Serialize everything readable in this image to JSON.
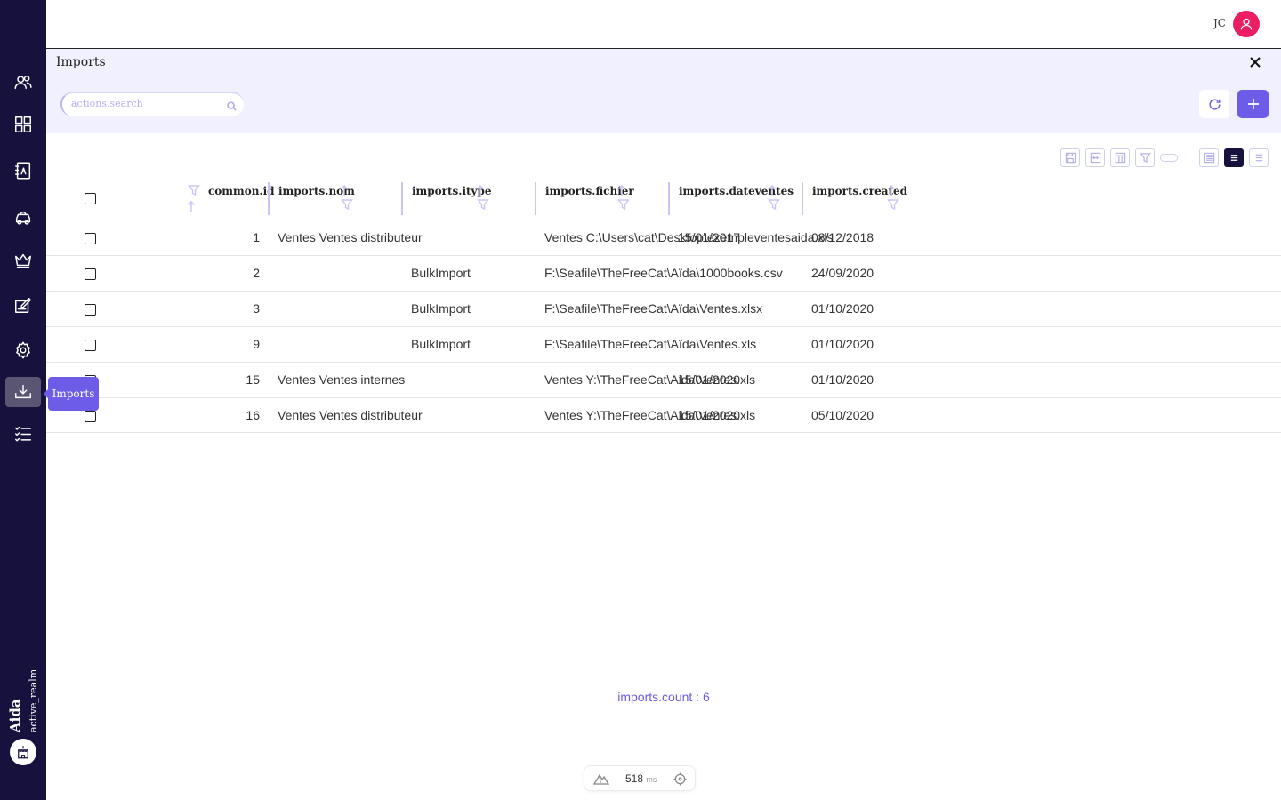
{
  "sidebar": {
    "items": [
      {
        "name": "users-icon"
      },
      {
        "name": "dashboard-icon"
      },
      {
        "name": "contacts-book-icon"
      },
      {
        "name": "car-icon"
      },
      {
        "name": "crown-icon"
      },
      {
        "name": "report-edit-icon"
      },
      {
        "name": "gear-icon"
      },
      {
        "name": "download-tray-icon",
        "active": true
      },
      {
        "name": "checklist-icon"
      }
    ],
    "tooltip": "Imports",
    "brand": "Aida",
    "realm": "active_realm",
    "realm_icon": "castle-icon"
  },
  "topbar": {
    "user_initials": "JC",
    "avatar_color": "#e91e63"
  },
  "panel": {
    "title": "Imports",
    "search_placeholder": "actions.search"
  },
  "colors": {
    "accent": "#6c5ce7",
    "sidebar_bg": "#17123d",
    "panel_bg": "#f1f0ff"
  },
  "table": {
    "columns": [
      "common.id",
      "imports.nom",
      "imports.itype",
      "imports.fichier",
      "imports.dateventes",
      "imports.created"
    ],
    "rows": [
      {
        "id": "1",
        "nom": "Ventes Ventes distributeur",
        "itype": "",
        "fichier": "Ventes C:\\Users\\cat\\Desktop\\exempleventesaida.xls",
        "dateventes": "15/01/2017",
        "created": "08/12/2018"
      },
      {
        "id": "2",
        "nom": "",
        "itype": "BulkImport",
        "fichier": "F:\\Seafile\\TheFreeCat\\Aïda\\1000books.csv",
        "dateventes": "",
        "created": "24/09/2020"
      },
      {
        "id": "3",
        "nom": "",
        "itype": "BulkImport",
        "fichier": "F:\\Seafile\\TheFreeCat\\Aïda\\Ventes.xlsx",
        "dateventes": "",
        "created": "01/10/2020"
      },
      {
        "id": "9",
        "nom": "",
        "itype": "BulkImport",
        "fichier": "F:\\Seafile\\TheFreeCat\\Aïda\\Ventes.xls",
        "dateventes": "",
        "created": "01/10/2020"
      },
      {
        "id": "15",
        "nom": "Ventes Ventes internes",
        "itype": "",
        "fichier": "Ventes Y:\\TheFreeCat\\Aida\\Ventes.xls",
        "dateventes": "15/01/2020",
        "created": "01/10/2020"
      },
      {
        "id": "16",
        "nom": "Ventes Ventes distributeur",
        "itype": "",
        "fichier": "Ventes Y:\\TheFreeCat\\Aida\\Ventes.xls",
        "dateventes": "15/01/2020",
        "created": "05/10/2020"
      }
    ]
  },
  "footer": {
    "count_text": "imports.count : 6",
    "perf_ms": "518",
    "perf_unit": "ms"
  }
}
